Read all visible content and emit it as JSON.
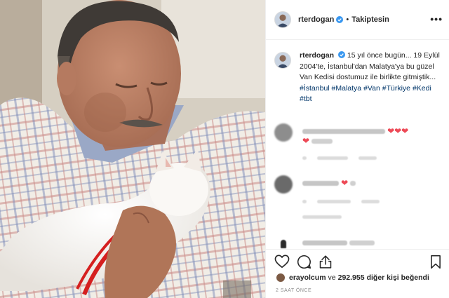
{
  "colors": {
    "link": "#003569",
    "heart": "#ed4956",
    "muted": "#8e8e8e",
    "verified": "#3897f0"
  },
  "header": {
    "username": "rterdogan",
    "separator": "•",
    "follow_label": "Takiptesin",
    "more_icon": "more-horizontal-icon"
  },
  "caption": {
    "username": "rterdogan",
    "text": "15 yıl önce bugün... 19 Eylül 2004'te, İstanbul'dan Malatya'ya bu güzel Van Kedisi dostumuz ile birlikte gitmiştik...",
    "hashtags": [
      "#İstanbul",
      "#Malatya",
      "#Van",
      "#Türkiye",
      "#Kedi",
      "#tbt"
    ]
  },
  "comments": [
    {
      "hearts": "❤❤❤",
      "second_line_heart": "❤"
    },
    {
      "hearts": "❤"
    },
    {
      "hearts": ""
    }
  ],
  "actions": {
    "icons": [
      "heart-icon",
      "comment-icon",
      "share-icon",
      "bookmark-icon"
    ]
  },
  "likes": {
    "user": "erayolcum",
    "connector": "ve",
    "count": "292.955",
    "suffix": "diğer kişi beğendi"
  },
  "timestamp": "2 SAAT ÖNCE"
}
